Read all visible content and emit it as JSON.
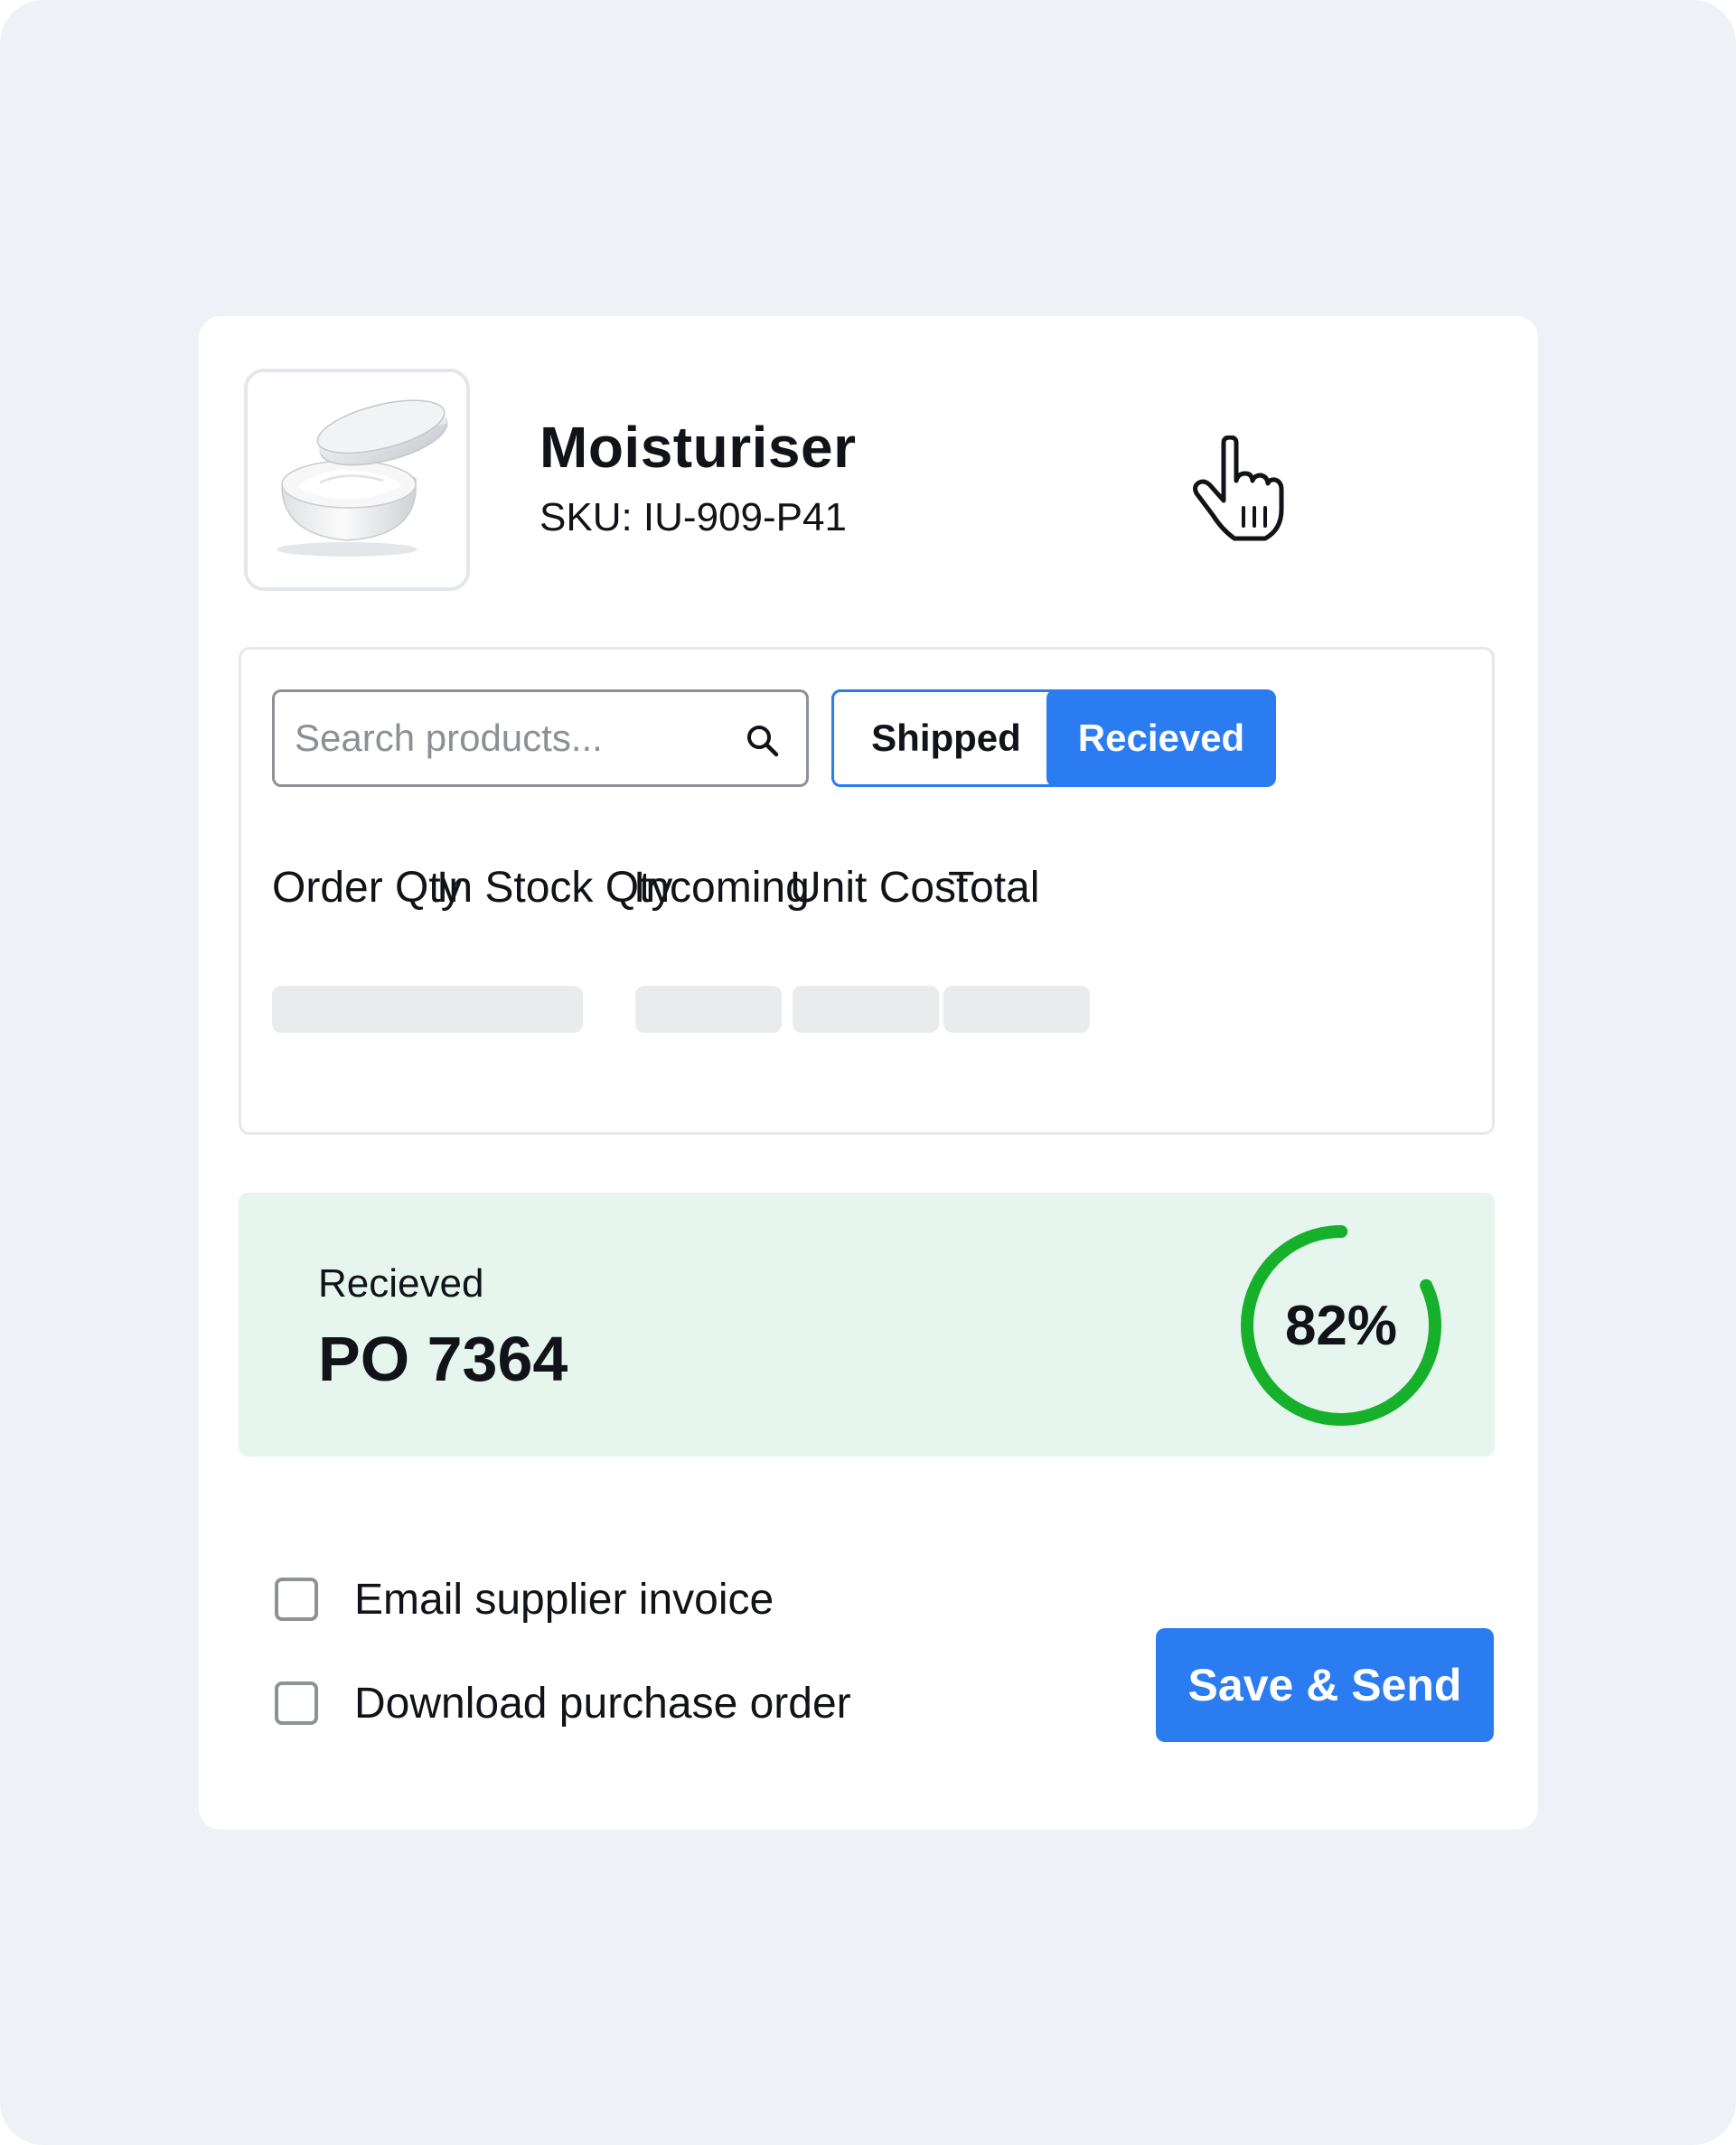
{
  "product": {
    "name": "Moisturiser",
    "sku": "SKU: IU-909-P41",
    "image_icon": "cream-jar-image"
  },
  "toolbar": {
    "search_placeholder": "Search products...",
    "search_value": "",
    "search_icon": "search-icon",
    "shipped_label": "Shipped",
    "received_label": "Recieved"
  },
  "table": {
    "columns": [
      "Order Qty",
      "In Stock Qty",
      "Incoming",
      "Unit Cost",
      "Total"
    ],
    "rows_loading": true
  },
  "summary": {
    "status": "Recieved",
    "po_number": "PO 7364",
    "progress": 82,
    "progress_label": "82%"
  },
  "options": [
    {
      "label": "Email supplier invoice",
      "checked": false
    },
    {
      "label": "Download purchase order",
      "checked": false
    }
  ],
  "actions": {
    "save_send_label": "Save & Send"
  },
  "colors": {
    "accent": "#2b7cf0",
    "progress": "#17b02a",
    "summary_bg": "#e6f6ef",
    "page_bg": "#eef2f7"
  }
}
